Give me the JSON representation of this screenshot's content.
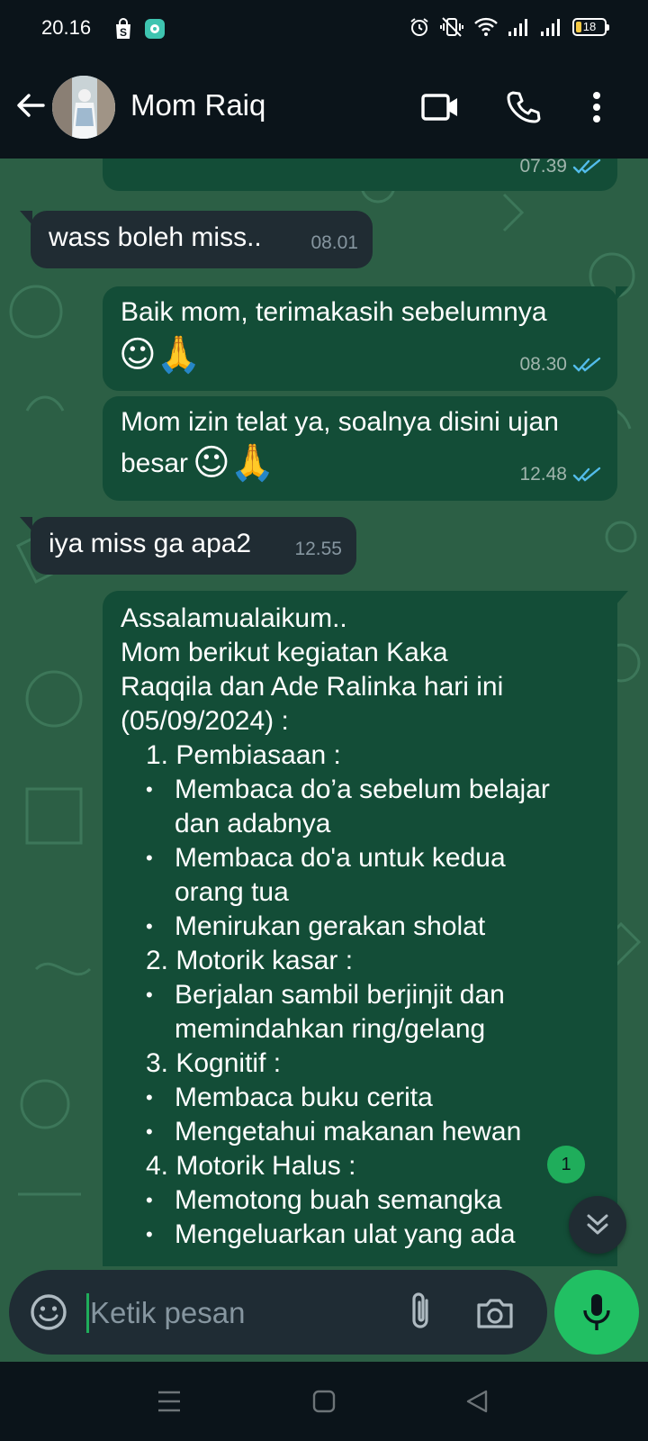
{
  "status_bar": {
    "time": "20.16",
    "battery_level": "18",
    "icons": [
      "shop-bag-icon",
      "app-notification-icon",
      "alarm-icon",
      "vibrate-off-icon",
      "wifi-icon",
      "signal-icon",
      "signal-icon",
      "battery-icon"
    ]
  },
  "header": {
    "contact_name": "Mom Raiq",
    "icons": [
      "back-arrow-icon",
      "video-call-icon",
      "phone-icon",
      "more-vertical-icon"
    ]
  },
  "messages": [
    {
      "direction": "out",
      "text": "",
      "time": "07.39",
      "read": true
    },
    {
      "direction": "in",
      "text": "wass boleh miss..",
      "time": "08.01"
    },
    {
      "direction": "out",
      "text": "Baik mom, terimakasih sebelumnya",
      "emoji": "☺🙏",
      "time": "08.30",
      "read": true
    },
    {
      "direction": "out",
      "text_line1": "Mom izin telat ya, soalnya disini ujan",
      "text_line2": "besar",
      "emoji": "☺🙏",
      "time": "12.48",
      "read": true
    },
    {
      "direction": "in",
      "text": "iya miss ga apa2",
      "time": "12.55"
    }
  ],
  "report": {
    "greeting": "Assalamualaikum..",
    "intro_1": "Mom berikut kegiatan Kaka",
    "intro_2": "Raqqila dan Ade Ralinka hari ini",
    "intro_3": "(05/09/2024) :",
    "sections": [
      {
        "title": "1. Pembiasaan :",
        "items": [
          [
            "Membaca do’a sebelum belajar",
            "dan adabnya"
          ],
          [
            "Membaca do'a untuk kedua",
            "orang tua"
          ],
          [
            "Menirukan gerakan sholat"
          ]
        ]
      },
      {
        "title": "2. Motorik kasar :",
        "items": [
          [
            "Berjalan sambil berjinjit dan",
            "memindahkan ring/gelang"
          ]
        ]
      },
      {
        "title": "3. Kognitif :",
        "items": [
          [
            "Membaca buku cerita"
          ],
          [
            "Mengetahui makanan hewan"
          ]
        ]
      },
      {
        "title": "4. Motorik Halus :",
        "items": [
          [
            "Memotong buah semangka"
          ],
          [
            "Mengeluarkan ulat yang ada"
          ]
        ]
      }
    ]
  },
  "unread_count": "1",
  "input": {
    "placeholder": "Ketik pesan",
    "value": ""
  },
  "colors": {
    "chat_bg": "#2c5f45",
    "bubble_out": "#134d37",
    "bubble_in": "#202c33",
    "accent_green": "#21c063",
    "read_tick": "#53bdeb"
  }
}
